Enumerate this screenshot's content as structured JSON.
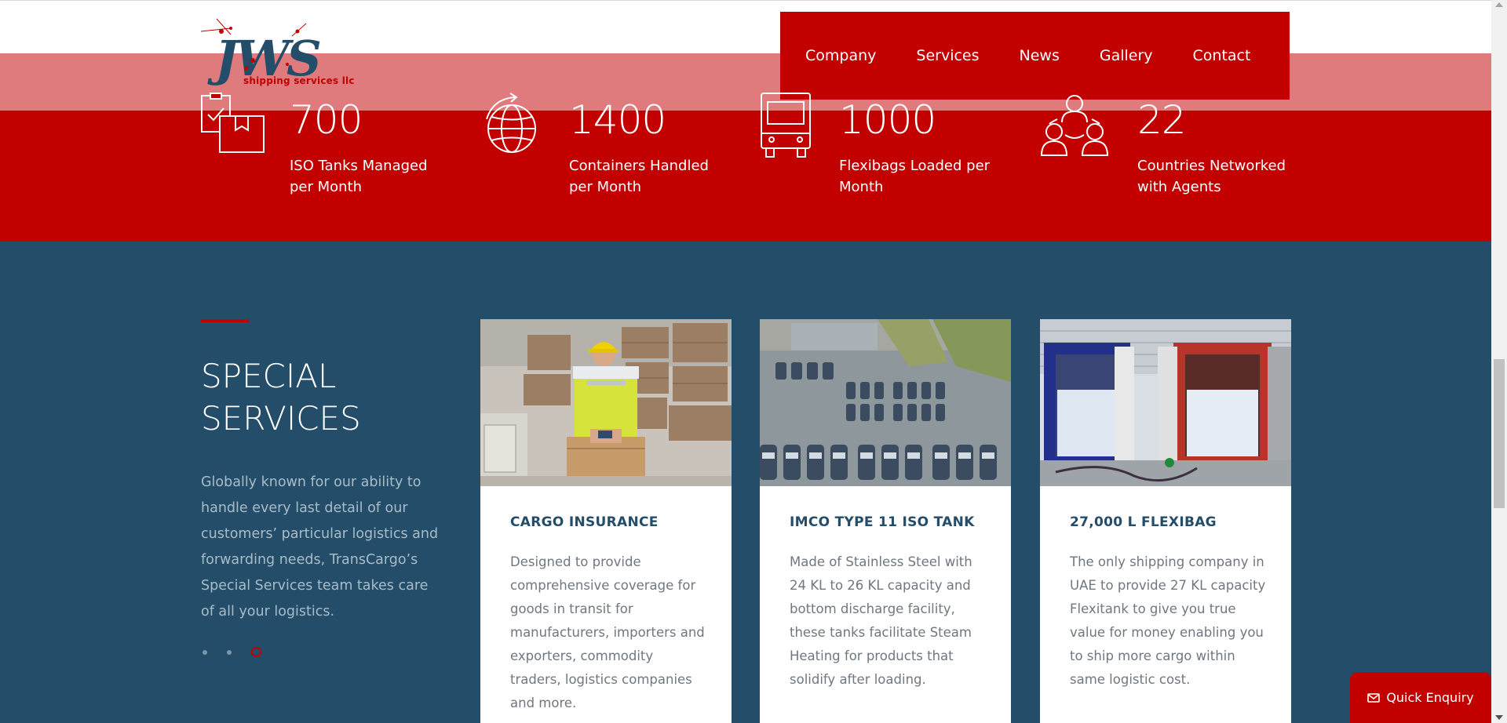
{
  "brand": {
    "logo_text": "JWS",
    "tagline": "shipping services llc"
  },
  "nav": {
    "items": [
      {
        "label": "Company"
      },
      {
        "label": "Services"
      },
      {
        "label": "News"
      },
      {
        "label": "Gallery"
      },
      {
        "label": "Contact"
      }
    ]
  },
  "stats": [
    {
      "icon": "clipboard-boxes-icon",
      "number": "700",
      "label": "ISO Tanks Managed per Month"
    },
    {
      "icon": "globe-arrow-icon",
      "number": "1400",
      "label": "Containers Handled per Month"
    },
    {
      "icon": "truck-front-icon",
      "number": "1000",
      "label": "Flexibags Loaded per Month"
    },
    {
      "icon": "people-network-icon",
      "number": "22",
      "label": "Countries Networked with Agents"
    }
  ],
  "special": {
    "title": "SPECIAL SERVICES",
    "description": "Globally known for our ability to handle every last detail of our customers’ particular logistics and forwarding needs, TransCargo’s Special Services team takes care of all your logistics.",
    "slider": {
      "total": 3,
      "active": 3
    }
  },
  "cards": [
    {
      "title": "CARGO INSURANCE",
      "text": "Designed to provide comprehensive coverage for goods in transit for manufacturers, importers and exporters, commodity traders, logistics companies and more."
    },
    {
      "title": "IMCO TYPE 11 ISO TANK",
      "text": "Made of Stainless Steel with 24 KL to 26 KL capacity and bottom discharge facility, these tanks facilitate Steam Heating for products that solidify after loading."
    },
    {
      "title": "27,000 L FLEXIBAG",
      "text": "The only shipping company in UAE to provide 27 KL capacity Flexitank to give you true value for money enabling you to ship more cargo within same logistic cost."
    }
  ],
  "quick_enquiry": {
    "label": "Quick Enquiry",
    "icon": "envelope-icon"
  },
  "colors": {
    "brand_red": "#c20000",
    "navy": "#234d68",
    "pink_band": "#e07b7d"
  }
}
